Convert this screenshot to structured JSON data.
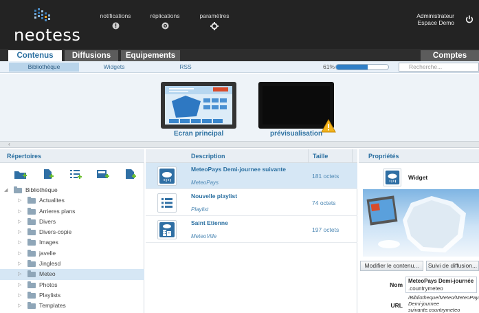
{
  "app": {
    "logo_text": "neotess"
  },
  "topnav": {
    "notifications": "notifications",
    "replications": "réplications",
    "parameters": "paramètres"
  },
  "user": {
    "name": "Administrateur",
    "space": "Espace Demo"
  },
  "tabs": {
    "contenus": "Contenus",
    "diffusions": "Diffusions",
    "equipements": "Equipements",
    "comptes": "Comptes"
  },
  "subtabs": {
    "bibliotheque": "Bibliothèque",
    "widgets": "Widgets",
    "rss": "RSS"
  },
  "quota": {
    "label": "61%",
    "percent": 61
  },
  "search": {
    "placeholder": "Recherche..."
  },
  "preview": {
    "main_screen_label": "Ecran principal",
    "preview_label": "prévisualisation"
  },
  "left_panel": {
    "title": "Répertoires",
    "tree": [
      {
        "label": "Bibliothèque",
        "level": 0,
        "expanded": true,
        "selected": false
      },
      {
        "label": "Actualites",
        "level": 1,
        "selected": false
      },
      {
        "label": "Arrieres plans",
        "level": 1,
        "selected": false
      },
      {
        "label": "Divers",
        "level": 1,
        "selected": false
      },
      {
        "label": "Divers-copie",
        "level": 1,
        "selected": false
      },
      {
        "label": "Images",
        "level": 1,
        "selected": false
      },
      {
        "label": "javelle",
        "level": 1,
        "selected": false
      },
      {
        "label": "Jinglesd",
        "level": 1,
        "selected": false
      },
      {
        "label": "Meteo",
        "level": 1,
        "selected": true
      },
      {
        "label": "Photos",
        "level": 1,
        "selected": false
      },
      {
        "label": "Playlists",
        "level": 1,
        "selected": false
      },
      {
        "label": "Templates",
        "level": 1,
        "selected": false
      }
    ]
  },
  "mid_panel": {
    "col_description": "Description",
    "col_size": "Taille",
    "files": [
      {
        "name": "MeteoPays Demi-journee suivante",
        "type": "MeteoPays",
        "size": "181 octets",
        "icon": "weather-icon",
        "selected": true
      },
      {
        "name": "Nouvelle playlist",
        "type": "Playlist",
        "size": "74 octets",
        "icon": "playlist-icon",
        "selected": false
      },
      {
        "name": "Saint Etienne",
        "type": "MeteoVille",
        "size": "197 octets",
        "icon": "city-weather-icon",
        "selected": false
      }
    ]
  },
  "right_panel": {
    "title": "Propriétés",
    "type_label": "Widget",
    "modify_button": "Modifier le contenu...",
    "follow_button": "Suivi de diffusion...",
    "name_key": "Nom",
    "name_value": "MeteoPays Demi-journée",
    "name_value_ext": ".countrymeteo",
    "url_key": "URL",
    "url_line1": "/Bibliotheque/Meteo/MeteoPays",
    "url_line2": "Demi-journee",
    "url_line3": "suivante.countrymeteo"
  },
  "colors": {
    "header_bg": "#232323",
    "accent_blue": "#2a6fa0",
    "selection": "#d6e7f5",
    "quota_fill": "#2f7ec6"
  }
}
